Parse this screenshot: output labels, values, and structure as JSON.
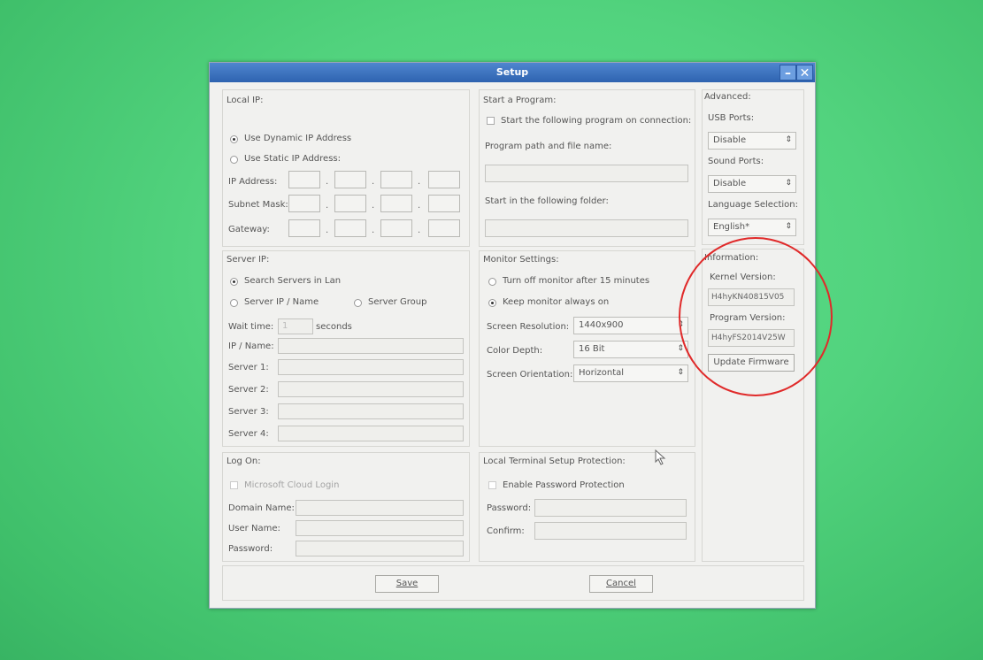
{
  "window": {
    "title": "Setup",
    "minimize_icon": "minimize-icon",
    "close_icon": "close-icon"
  },
  "local_ip": {
    "title": "Local IP:",
    "dynamic_label": "Use Dynamic IP Address",
    "static_label": "Use Static IP Address:",
    "ip_label": "IP Address:",
    "subnet_label": "Subnet Mask:",
    "gateway_label": "Gateway:",
    "selected": "dynamic"
  },
  "start_program": {
    "title": "Start a Program:",
    "checkbox_label": "Start the following program on connection:",
    "path_label": "Program path and file name:",
    "path_value": "",
    "folder_label": "Start in the following folder:",
    "folder_value": ""
  },
  "advanced": {
    "title": "Advanced:",
    "usb_label": "USB Ports:",
    "usb_value": "Disable",
    "sound_label": "Sound Ports:",
    "sound_value": "Disable",
    "language_label": "Language Selection:",
    "language_value": "English*"
  },
  "information": {
    "title": "Information:",
    "kernel_label": "Kernel Version:",
    "kernel_value": "H4hyKN40815V05",
    "program_label": "Program Version:",
    "program_value": "H4hyFS2014V25W",
    "update_button": "Update Firmware",
    "annotation_color": "#e02a2a"
  },
  "server_ip": {
    "title": "Server IP:",
    "search_label": "Search Servers in Lan",
    "server_ip_name_label": "Server IP / Name",
    "server_group_label": "Server Group",
    "wait_label": "Wait time:",
    "wait_value": "1",
    "seconds_label": "seconds",
    "ip_name_label": "IP / Name:",
    "server1_label": "Server 1:",
    "server2_label": "Server 2:",
    "server3_label": "Server 3:",
    "server4_label": "Server 4:",
    "selected": "search"
  },
  "monitor": {
    "title": "Monitor Settings:",
    "turn_off_label": "Turn off monitor after 15 minutes",
    "keep_on_label": "Keep monitor always on",
    "resolution_label": "Screen Resolution:",
    "resolution_value": "1440x900",
    "depth_label": "Color Depth:",
    "depth_value": "16 Bit",
    "orientation_label": "Screen Orientation:",
    "orientation_value": "Horizontal",
    "selected": "keep_on"
  },
  "logon": {
    "title": "Log On:",
    "cloud_label": "Microsoft Cloud Login",
    "domain_label": "Domain Name:",
    "user_label": "User Name:",
    "password_label": "Password:"
  },
  "protection": {
    "title": "Local Terminal Setup Protection:",
    "enable_label": "Enable Password Protection",
    "password_label": "Password:",
    "confirm_label": "Confirm:"
  },
  "footer": {
    "save_label": "Save",
    "cancel_label": "Cancel"
  }
}
